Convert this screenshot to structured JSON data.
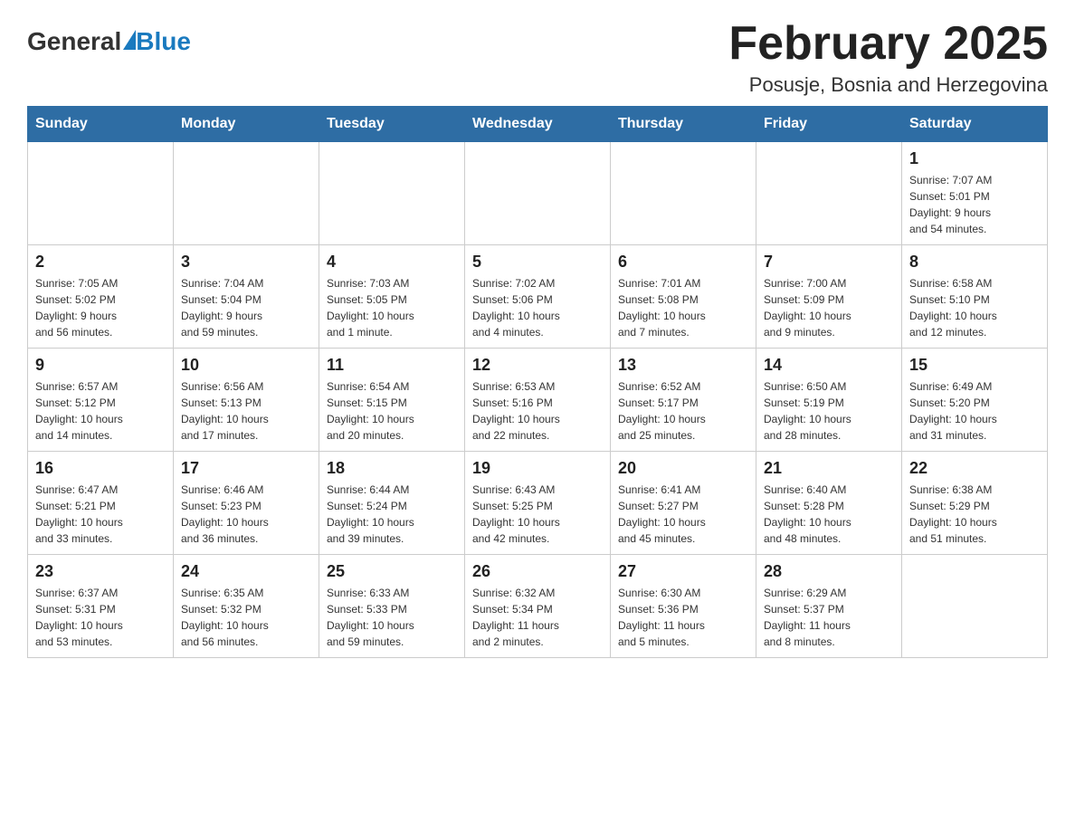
{
  "header": {
    "logo_general": "General",
    "logo_blue": "Blue",
    "title": "February 2025",
    "subtitle": "Posusje, Bosnia and Herzegovina"
  },
  "weekdays": [
    "Sunday",
    "Monday",
    "Tuesday",
    "Wednesday",
    "Thursday",
    "Friday",
    "Saturday"
  ],
  "weeks": [
    [
      {
        "day": "",
        "info": ""
      },
      {
        "day": "",
        "info": ""
      },
      {
        "day": "",
        "info": ""
      },
      {
        "day": "",
        "info": ""
      },
      {
        "day": "",
        "info": ""
      },
      {
        "day": "",
        "info": ""
      },
      {
        "day": "1",
        "info": "Sunrise: 7:07 AM\nSunset: 5:01 PM\nDaylight: 9 hours\nand 54 minutes."
      }
    ],
    [
      {
        "day": "2",
        "info": "Sunrise: 7:05 AM\nSunset: 5:02 PM\nDaylight: 9 hours\nand 56 minutes."
      },
      {
        "day": "3",
        "info": "Sunrise: 7:04 AM\nSunset: 5:04 PM\nDaylight: 9 hours\nand 59 minutes."
      },
      {
        "day": "4",
        "info": "Sunrise: 7:03 AM\nSunset: 5:05 PM\nDaylight: 10 hours\nand 1 minute."
      },
      {
        "day": "5",
        "info": "Sunrise: 7:02 AM\nSunset: 5:06 PM\nDaylight: 10 hours\nand 4 minutes."
      },
      {
        "day": "6",
        "info": "Sunrise: 7:01 AM\nSunset: 5:08 PM\nDaylight: 10 hours\nand 7 minutes."
      },
      {
        "day": "7",
        "info": "Sunrise: 7:00 AM\nSunset: 5:09 PM\nDaylight: 10 hours\nand 9 minutes."
      },
      {
        "day": "8",
        "info": "Sunrise: 6:58 AM\nSunset: 5:10 PM\nDaylight: 10 hours\nand 12 minutes."
      }
    ],
    [
      {
        "day": "9",
        "info": "Sunrise: 6:57 AM\nSunset: 5:12 PM\nDaylight: 10 hours\nand 14 minutes."
      },
      {
        "day": "10",
        "info": "Sunrise: 6:56 AM\nSunset: 5:13 PM\nDaylight: 10 hours\nand 17 minutes."
      },
      {
        "day": "11",
        "info": "Sunrise: 6:54 AM\nSunset: 5:15 PM\nDaylight: 10 hours\nand 20 minutes."
      },
      {
        "day": "12",
        "info": "Sunrise: 6:53 AM\nSunset: 5:16 PM\nDaylight: 10 hours\nand 22 minutes."
      },
      {
        "day": "13",
        "info": "Sunrise: 6:52 AM\nSunset: 5:17 PM\nDaylight: 10 hours\nand 25 minutes."
      },
      {
        "day": "14",
        "info": "Sunrise: 6:50 AM\nSunset: 5:19 PM\nDaylight: 10 hours\nand 28 minutes."
      },
      {
        "day": "15",
        "info": "Sunrise: 6:49 AM\nSunset: 5:20 PM\nDaylight: 10 hours\nand 31 minutes."
      }
    ],
    [
      {
        "day": "16",
        "info": "Sunrise: 6:47 AM\nSunset: 5:21 PM\nDaylight: 10 hours\nand 33 minutes."
      },
      {
        "day": "17",
        "info": "Sunrise: 6:46 AM\nSunset: 5:23 PM\nDaylight: 10 hours\nand 36 minutes."
      },
      {
        "day": "18",
        "info": "Sunrise: 6:44 AM\nSunset: 5:24 PM\nDaylight: 10 hours\nand 39 minutes."
      },
      {
        "day": "19",
        "info": "Sunrise: 6:43 AM\nSunset: 5:25 PM\nDaylight: 10 hours\nand 42 minutes."
      },
      {
        "day": "20",
        "info": "Sunrise: 6:41 AM\nSunset: 5:27 PM\nDaylight: 10 hours\nand 45 minutes."
      },
      {
        "day": "21",
        "info": "Sunrise: 6:40 AM\nSunset: 5:28 PM\nDaylight: 10 hours\nand 48 minutes."
      },
      {
        "day": "22",
        "info": "Sunrise: 6:38 AM\nSunset: 5:29 PM\nDaylight: 10 hours\nand 51 minutes."
      }
    ],
    [
      {
        "day": "23",
        "info": "Sunrise: 6:37 AM\nSunset: 5:31 PM\nDaylight: 10 hours\nand 53 minutes."
      },
      {
        "day": "24",
        "info": "Sunrise: 6:35 AM\nSunset: 5:32 PM\nDaylight: 10 hours\nand 56 minutes."
      },
      {
        "day": "25",
        "info": "Sunrise: 6:33 AM\nSunset: 5:33 PM\nDaylight: 10 hours\nand 59 minutes."
      },
      {
        "day": "26",
        "info": "Sunrise: 6:32 AM\nSunset: 5:34 PM\nDaylight: 11 hours\nand 2 minutes."
      },
      {
        "day": "27",
        "info": "Sunrise: 6:30 AM\nSunset: 5:36 PM\nDaylight: 11 hours\nand 5 minutes."
      },
      {
        "day": "28",
        "info": "Sunrise: 6:29 AM\nSunset: 5:37 PM\nDaylight: 11 hours\nand 8 minutes."
      },
      {
        "day": "",
        "info": ""
      }
    ]
  ]
}
